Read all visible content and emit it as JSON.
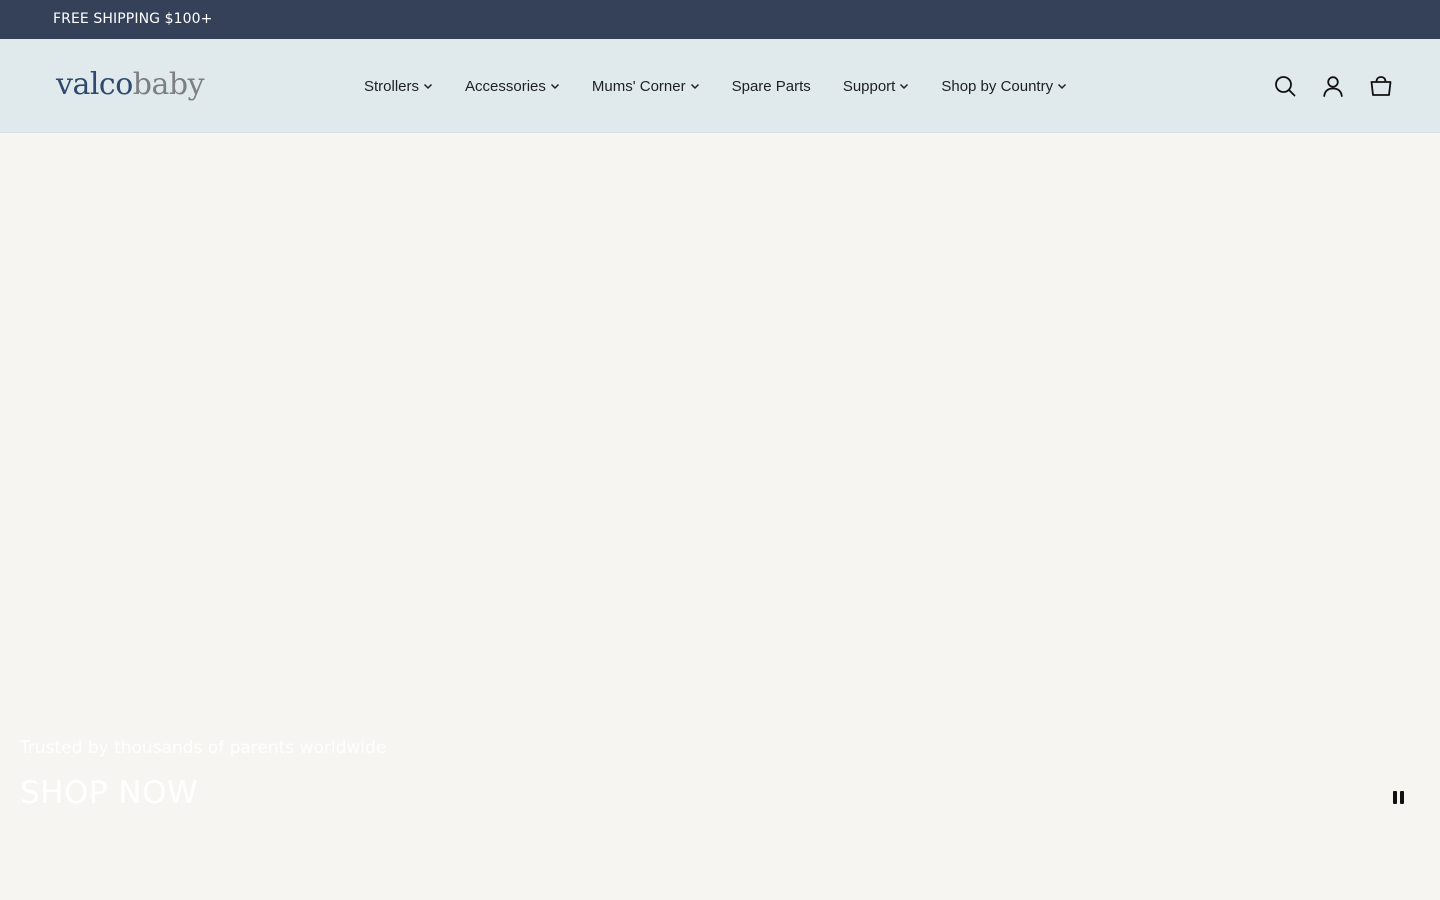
{
  "announcement": {
    "text": "FREE SHIPPING $100+"
  },
  "header": {
    "logo": {
      "part1": "valco",
      "part2": "baby"
    },
    "nav": [
      {
        "label": "Strollers",
        "has_dropdown": true
      },
      {
        "label": "Accessories",
        "has_dropdown": true
      },
      {
        "label": "Mums' Corner",
        "has_dropdown": true
      },
      {
        "label": "Spare Parts",
        "has_dropdown": false
      },
      {
        "label": "Support",
        "has_dropdown": true
      },
      {
        "label": "Shop by Country",
        "has_dropdown": true
      }
    ],
    "icons": [
      "search-icon",
      "account-icon",
      "cart-icon"
    ]
  },
  "hero": {
    "subtitle": "Trusted by thousands of parents worldwide",
    "cta": "SHOP NOW",
    "pause_icon": "pause-icon"
  },
  "colors": {
    "announcement_bg": "#354059",
    "header_bg": "#e0eaed",
    "hero_bg": "#f6f5f2",
    "logo_primary": "#2f4a6e",
    "logo_secondary": "#7d7f82",
    "text_dark": "#1d1f24",
    "hero_text": "#ffffff"
  }
}
